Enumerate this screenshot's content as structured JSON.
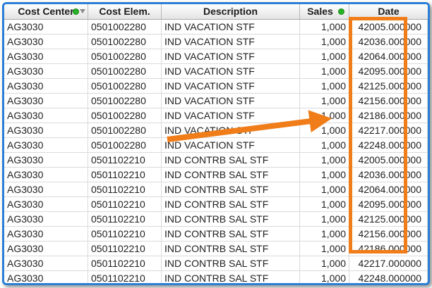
{
  "columns": {
    "cost_center": "Cost Center",
    "cost_elem": "Cost Elem.",
    "description": "Description",
    "sales": "Sales",
    "date": "Date"
  },
  "rows": [
    {
      "cc": "AG3030",
      "ce": "0501002280",
      "desc": "IND VACATION STF",
      "sales": "1,000",
      "date": "42005.000000"
    },
    {
      "cc": "AG3030",
      "ce": "0501002280",
      "desc": "IND VACATION STF",
      "sales": "1,000",
      "date": "42036.000000"
    },
    {
      "cc": "AG3030",
      "ce": "0501002280",
      "desc": "IND VACATION STF",
      "sales": "1,000",
      "date": "42064.000000"
    },
    {
      "cc": "AG3030",
      "ce": "0501002280",
      "desc": "IND VACATION STF",
      "sales": "1,000",
      "date": "42095.000000"
    },
    {
      "cc": "AG3030",
      "ce": "0501002280",
      "desc": "IND VACATION STF",
      "sales": "1,000",
      "date": "42125.000000"
    },
    {
      "cc": "AG3030",
      "ce": "0501002280",
      "desc": "IND VACATION STF",
      "sales": "1,000",
      "date": "42156.000000"
    },
    {
      "cc": "AG3030",
      "ce": "0501002280",
      "desc": "IND VACATION STF",
      "sales": "1,000",
      "date": "42186.000000"
    },
    {
      "cc": "AG3030",
      "ce": "0501002280",
      "desc": "IND VACATION STF",
      "sales": "1,000",
      "date": "42217.000000"
    },
    {
      "cc": "AG3030",
      "ce": "0501002280",
      "desc": "IND VACATION STF",
      "sales": "1,000",
      "date": "42248.000000"
    },
    {
      "cc": "AG3030",
      "ce": "0501102210",
      "desc": "IND CONTRB SAL STF",
      "sales": "1,000",
      "date": "42005.000000"
    },
    {
      "cc": "AG3030",
      "ce": "0501102210",
      "desc": "IND CONTRB SAL STF",
      "sales": "1,000",
      "date": "42036.000000"
    },
    {
      "cc": "AG3030",
      "ce": "0501102210",
      "desc": "IND CONTRB SAL STF",
      "sales": "1,000",
      "date": "42064.000000"
    },
    {
      "cc": "AG3030",
      "ce": "0501102210",
      "desc": "IND CONTRB SAL STF",
      "sales": "1,000",
      "date": "42095.000000"
    },
    {
      "cc": "AG3030",
      "ce": "0501102210",
      "desc": "IND CONTRB SAL STF",
      "sales": "1,000",
      "date": "42125.000000"
    },
    {
      "cc": "AG3030",
      "ce": "0501102210",
      "desc": "IND CONTRB SAL STF",
      "sales": "1,000",
      "date": "42156.000000"
    },
    {
      "cc": "AG3030",
      "ce": "0501102210",
      "desc": "IND CONTRB SAL STF",
      "sales": "1,000",
      "date": "42186.000000"
    },
    {
      "cc": "AG3030",
      "ce": "0501102210",
      "desc": "IND CONTRB SAL STF",
      "sales": "1,000",
      "date": "42217.000000"
    },
    {
      "cc": "AG3030",
      "ce": "0501102210",
      "desc": "IND CONTRB SAL STF",
      "sales": "1,000",
      "date": "42248.000000"
    }
  ],
  "icons": {
    "filter_indicator": "green-dot-icon",
    "sort_indicator": "sort-triangle-icon"
  },
  "colors": {
    "annotation": "#f07d19",
    "frame": "#2b7fd6",
    "filter_dot": "#27b327"
  }
}
